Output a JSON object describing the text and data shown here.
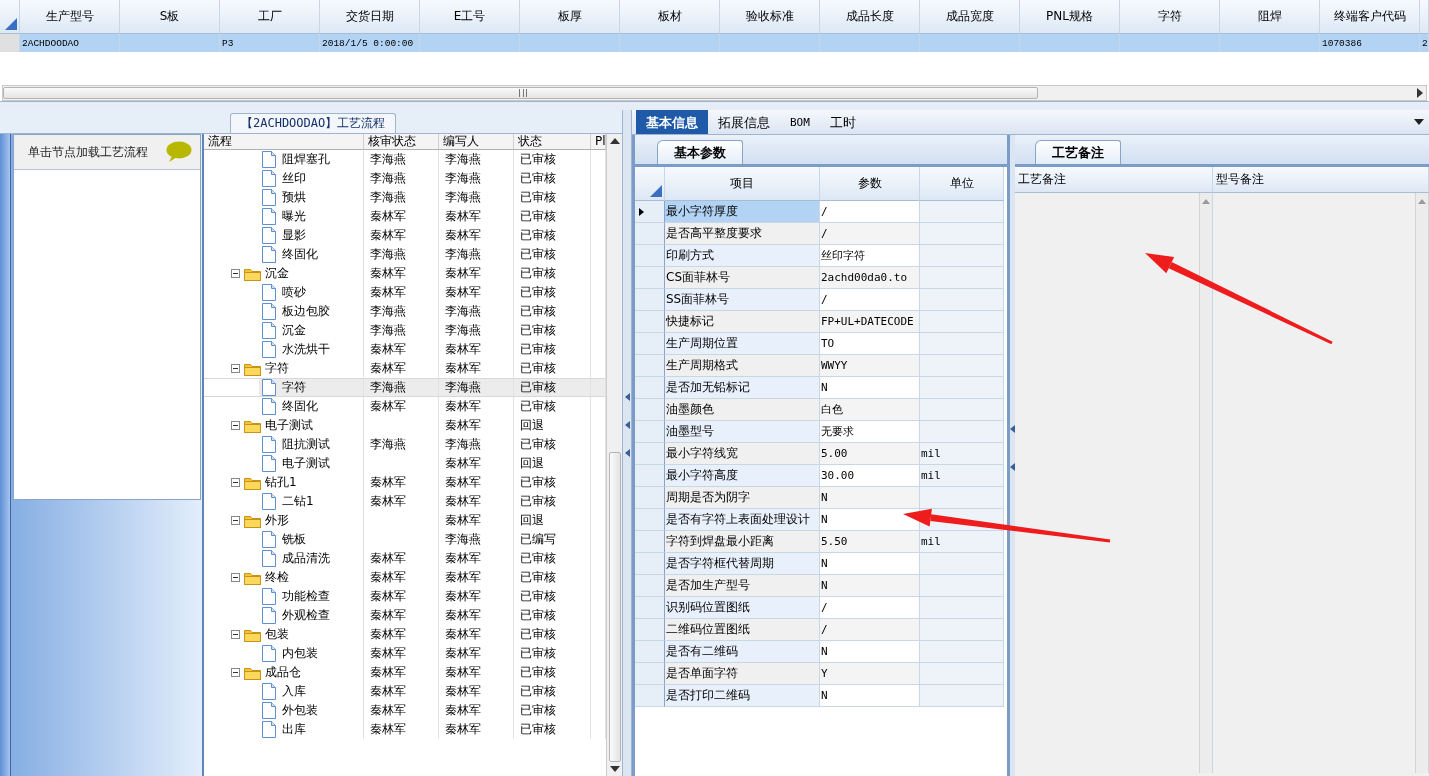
{
  "top_grid": {
    "columns": [
      "生产型号",
      "S板",
      "工厂",
      "交货日期",
      "E工号",
      "板厚",
      "板材",
      "验收标准",
      "成品长度",
      "成品宽度",
      "PNL规格",
      "字符",
      "阻焊",
      "终端客户代码"
    ],
    "rows": [
      {
        "selected": true,
        "cells": [
          "2ACHDOODAO",
          "",
          "P3",
          "2018/1/5 0:00:00",
          "",
          "",
          "",
          "",
          "",
          "",
          "",
          "",
          "",
          "1070386",
          "2"
        ]
      }
    ]
  },
  "flow_panel": {
    "title": "【2ACHDOODAO】工艺流程",
    "hint": "单击节点加载工艺流程",
    "columns": [
      "流程",
      "核审状态",
      "编写人",
      "状态",
      "Pl"
    ],
    "tree": [
      {
        "children": [
          {
            "name": "阻焊塞孔",
            "reviewer": "李海燕",
            "author": "李海燕",
            "status": "已审核",
            "selected": false
          },
          {
            "name": "丝印",
            "reviewer": "李海燕",
            "author": "李海燕",
            "status": "已审核",
            "selected": false
          },
          {
            "name": "预烘",
            "reviewer": "李海燕",
            "author": "李海燕",
            "status": "已审核",
            "selected": false
          },
          {
            "name": "曝光",
            "reviewer": "秦林军",
            "author": "秦林军",
            "status": "已审核",
            "selected": false
          },
          {
            "name": "显影",
            "reviewer": "秦林军",
            "author": "秦林军",
            "status": "已审核",
            "selected": false
          },
          {
            "name": "终固化",
            "reviewer": "李海燕",
            "author": "李海燕",
            "status": "已审核",
            "selected": false
          }
        ]
      },
      {
        "name": "沉金",
        "reviewer": "秦林军",
        "author": "秦林军",
        "status": "已审核",
        "selected": false,
        "expanded": true,
        "children": [
          {
            "name": "喷砂",
            "reviewer": "秦林军",
            "author": "秦林军",
            "status": "已审核",
            "selected": false
          },
          {
            "name": "板边包胶",
            "reviewer": "李海燕",
            "author": "李海燕",
            "status": "已审核",
            "selected": false
          },
          {
            "name": "沉金",
            "reviewer": "李海燕",
            "author": "李海燕",
            "status": "已审核",
            "selected": false
          },
          {
            "name": "水洗烘干",
            "reviewer": "秦林军",
            "author": "秦林军",
            "status": "已审核",
            "selected": false
          }
        ]
      },
      {
        "name": "字符",
        "reviewer": "秦林军",
        "author": "秦林军",
        "status": "已审核",
        "selected": false,
        "expanded": true,
        "children": [
          {
            "name": "字符",
            "reviewer": "李海燕",
            "author": "李海燕",
            "status": "已审核",
            "selected": true
          },
          {
            "name": "终固化",
            "reviewer": "秦林军",
            "author": "秦林军",
            "status": "已审核",
            "selected": false
          }
        ]
      },
      {
        "name": "电子测试",
        "author": "秦林军",
        "status": "回退",
        "selected": false,
        "expanded": true,
        "children": [
          {
            "name": "阻抗测试",
            "reviewer": "李海燕",
            "author": "李海燕",
            "status": "已审核",
            "selected": false
          },
          {
            "name": "电子测试",
            "author": "秦林军",
            "status": "回退",
            "selected": false
          }
        ]
      },
      {
        "name": "钻孔1",
        "reviewer": "秦林军",
        "author": "秦林军",
        "status": "已审核",
        "selected": false,
        "expanded": true,
        "children": [
          {
            "name": "二钻1",
            "reviewer": "秦林军",
            "author": "秦林军",
            "status": "已审核",
            "selected": false
          }
        ]
      },
      {
        "name": "外形",
        "author": "秦林军",
        "status": "回退",
        "selected": false,
        "expanded": true,
        "children": [
          {
            "name": "铣板",
            "author": "李海燕",
            "status": "已编写",
            "selected": false
          },
          {
            "name": "成品清洗",
            "reviewer": "秦林军",
            "author": "秦林军",
            "status": "已审核",
            "selected": false
          }
        ]
      },
      {
        "name": "终检",
        "reviewer": "秦林军",
        "author": "秦林军",
        "status": "已审核",
        "selected": false,
        "expanded": true,
        "children": [
          {
            "name": "功能检查",
            "reviewer": "秦林军",
            "author": "秦林军",
            "status": "已审核",
            "selected": false
          },
          {
            "name": "外观检查",
            "reviewer": "秦林军",
            "author": "秦林军",
            "status": "已审核",
            "selected": false
          }
        ]
      },
      {
        "name": "包装",
        "reviewer": "秦林军",
        "author": "秦林军",
        "status": "已审核",
        "selected": false,
        "expanded": true,
        "children": [
          {
            "name": "内包装",
            "reviewer": "秦林军",
            "author": "秦林军",
            "status": "已审核",
            "selected": false
          }
        ]
      },
      {
        "name": "成品仓",
        "reviewer": "秦林军",
        "author": "秦林军",
        "status": "已审核",
        "selected": false,
        "expanded": true,
        "children": [
          {
            "name": "入库",
            "reviewer": "秦林军",
            "author": "秦林军",
            "status": "已审核",
            "selected": false
          },
          {
            "name": "外包装",
            "reviewer": "秦林军",
            "author": "秦林军",
            "status": "已审核",
            "selected": false
          },
          {
            "name": "出库",
            "reviewer": "秦林军",
            "author": "秦林军",
            "status": "已审核",
            "selected": false
          }
        ]
      }
    ]
  },
  "info_tabs": [
    {
      "label": "基本信息",
      "selected": true
    },
    {
      "label": "拓展信息",
      "selected": false
    },
    {
      "label": "BOM",
      "selected": false
    },
    {
      "label": "工时",
      "selected": false
    }
  ],
  "params_panel": {
    "tab": "基本参数",
    "columns": [
      "项目",
      "参数",
      "单位"
    ],
    "rows": [
      {
        "item": "最小字符厚度",
        "value": "/",
        "selected": true
      },
      {
        "item": "是否高平整度要求",
        "value": "/",
        "selected": false
      },
      {
        "item": "印刷方式",
        "value": "丝印字符",
        "selected": false
      },
      {
        "item": "CS面菲林号",
        "value": "2achd00da0.to",
        "selected": false
      },
      {
        "item": "SS面菲林号",
        "value": "/",
        "selected": false
      },
      {
        "item": "快捷标记",
        "value": "FP+UL+DATECODE",
        "selected": false
      },
      {
        "item": "生产周期位置",
        "value": "TO",
        "selected": false
      },
      {
        "item": "生产周期格式",
        "value": "WWYY",
        "selected": false
      },
      {
        "item": "是否加无铅标记",
        "value": "N",
        "selected": false
      },
      {
        "item": "油墨颜色",
        "value": "白色",
        "selected": false
      },
      {
        "item": "油墨型号",
        "value": "无要求",
        "selected": false
      },
      {
        "item": "最小字符线宽",
        "value": "5.00",
        "unit": "mil",
        "selected": false
      },
      {
        "item": "最小字符高度",
        "value": "30.00",
        "unit": "mil",
        "selected": false
      },
      {
        "item": "周期是否为阴字",
        "value": "N",
        "selected": false
      },
      {
        "item": "是否有字符上表面处理设计",
        "value": "N",
        "selected": false
      },
      {
        "item": "字符到焊盘最小距离",
        "value": "5.50",
        "unit": "mil",
        "selected": false
      },
      {
        "item": "是否字符框代替周期",
        "value": "N",
        "selected": false
      },
      {
        "item": "是否加生产型号",
        "value": "N",
        "selected": false
      },
      {
        "item": "识别码位置图纸",
        "value": "/",
        "selected": false
      },
      {
        "item": "二维码位置图纸",
        "value": "/",
        "selected": false
      },
      {
        "item": "是否有二维码",
        "value": "N",
        "selected": false
      },
      {
        "item": "是否单面字符",
        "value": "Y",
        "selected": false
      },
      {
        "item": "是否打印二维码",
        "value": "N",
        "selected": false
      }
    ]
  },
  "notes_panel": {
    "tab": "工艺备注",
    "columns": [
      "工艺备注",
      "型号备注"
    ]
  },
  "annotations": [
    {
      "kind": "arrow"
    },
    {
      "kind": "arrow"
    }
  ]
}
